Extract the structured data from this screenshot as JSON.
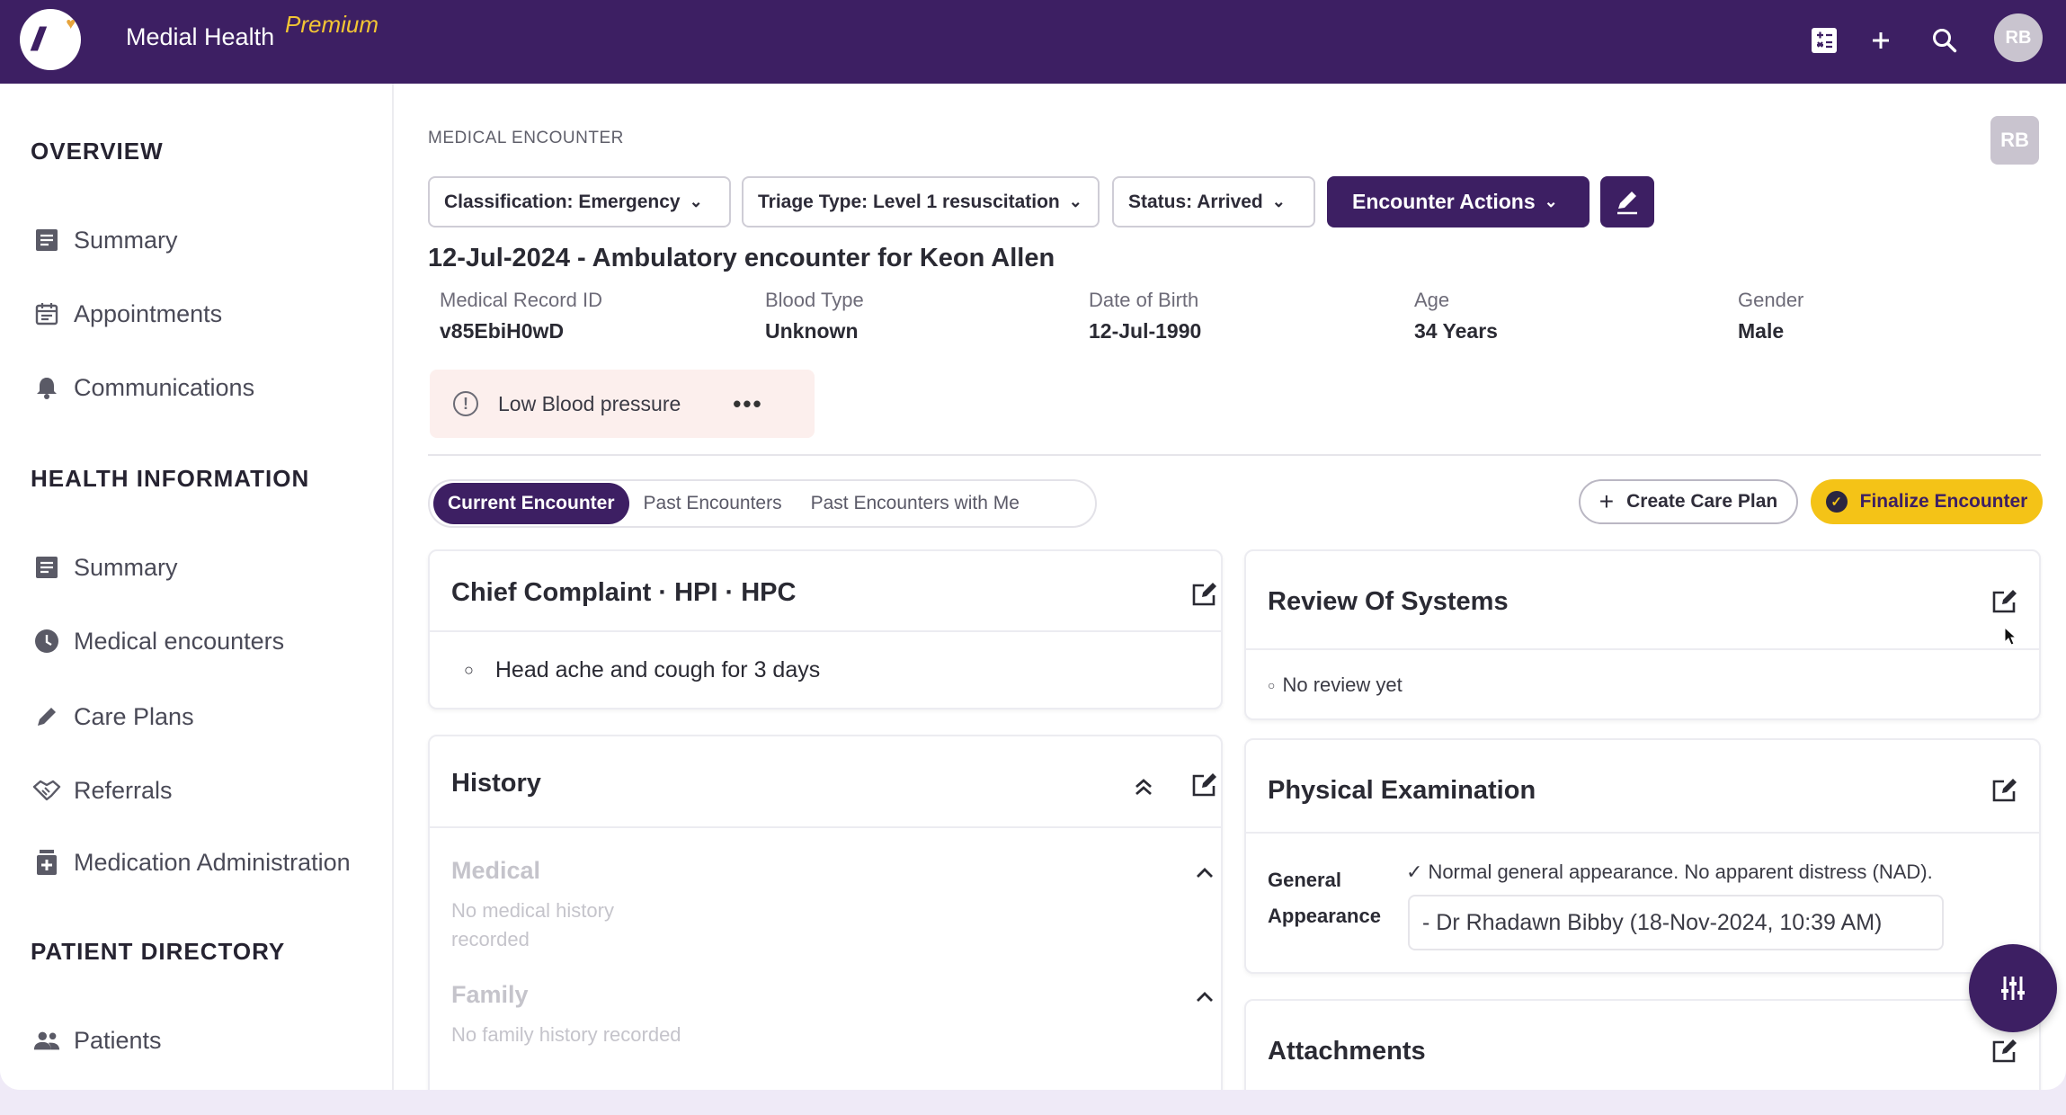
{
  "topbar": {
    "brand": "Medial Health",
    "premium": "Premium",
    "avatar": "RB"
  },
  "sidebar": {
    "overview_heading": "OVERVIEW",
    "overview_items": [
      "Summary",
      "Appointments",
      "Communications"
    ],
    "health_heading": "HEALTH INFORMATION",
    "health_items": [
      "Summary",
      "Medical encounters",
      "Care Plans",
      "Referrals",
      "Medication Administration"
    ],
    "directory_heading": "PATIENT DIRECTORY",
    "directory_items": [
      "Patients"
    ]
  },
  "header": {
    "section": "MEDICAL ENCOUNTER",
    "badge": "RB",
    "classification": "Classification: Emergency",
    "triage": "Triage Type: Level 1 resuscitation",
    "status": "Status: Arrived",
    "actions": "Encounter Actions",
    "title": "12-Jul-2024 - Ambulatory encounter for Keon Allen"
  },
  "patient": {
    "mrn_label": "Medical Record ID",
    "mrn": "v85EbiH0wD",
    "blood_label": "Blood Type",
    "blood": "Unknown",
    "dob_label": "Date of Birth",
    "dob": "12-Jul-1990",
    "age_label": "Age",
    "age": "34 Years",
    "gender_label": "Gender",
    "gender": "Male"
  },
  "alert": {
    "text": "Low Blood pressure",
    "more": "•••"
  },
  "tabs": [
    "Current Encounter",
    "Past Encounters",
    "Past Encounters with Me"
  ],
  "actions": {
    "care_plan": "Create Care Plan",
    "finalize": "Finalize Encounter"
  },
  "chief_complaint": {
    "title": "Chief Complaint · HPI · HPC",
    "item": "Head ache and cough for 3 days"
  },
  "history": {
    "title": "History",
    "medical_head": "Medical",
    "medical_text": "No medical history recorded",
    "family_head": "Family",
    "family_text": "No family history recorded"
  },
  "review": {
    "title": "Review Of Systems",
    "item": "No review yet"
  },
  "physical": {
    "title": "Physical Examination",
    "label": "General Appearance",
    "finding": "Normal general appearance. No apparent distress (NAD).",
    "author": "- Dr Rhadawn Bibby (18-Nov-2024, 10:39 AM)"
  },
  "attachments": {
    "title": "Attachments"
  }
}
